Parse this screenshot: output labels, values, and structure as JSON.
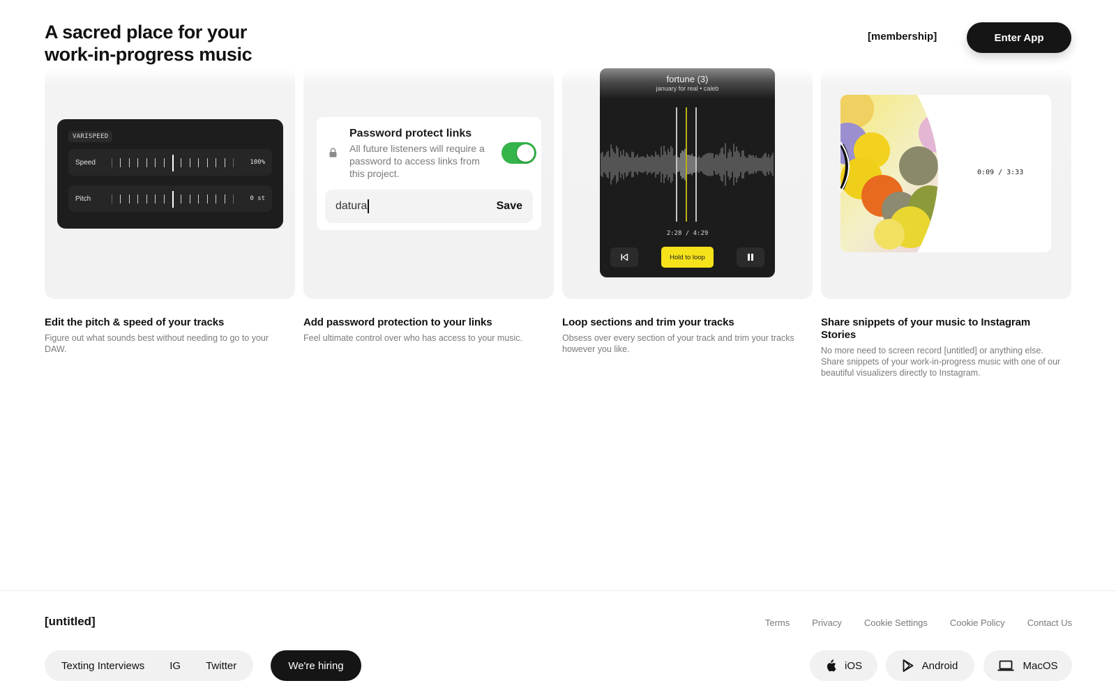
{
  "header": {
    "title": "A sacred place for your work-in-progress music",
    "membership_link": "[membership]",
    "enter_app": "Enter App"
  },
  "cards": {
    "varispeed": {
      "label": "VARISPEED",
      "rows": [
        {
          "name": "Speed",
          "value": "100%"
        },
        {
          "name": "Pitch",
          "value": "0 st"
        }
      ]
    },
    "password": {
      "title": "Password protect links",
      "description": "All future listeners will require a password to access links from this project.",
      "toggle_on": true,
      "input_value": "datura",
      "save_label": "Save"
    },
    "player": {
      "track_title": "fortune (3)",
      "track_sub": "january for real  • caleb",
      "time": "2:28 / 4:29",
      "hold_to_loop": "Hold to loop"
    },
    "snippet": {
      "time": "0:09 / 3:33"
    }
  },
  "features": [
    {
      "title": "Edit the pitch & speed of your tracks",
      "desc": "Figure out what sounds best without needing to go to your DAW."
    },
    {
      "title": "Add password protection to your links",
      "desc": "Feel ultimate control over who has access to your music."
    },
    {
      "title": "Loop sections and trim your tracks",
      "desc": "Obsess over every section of your track and trim your tracks however you like."
    },
    {
      "title": "Share snippets of your music to Instagram Stories",
      "desc": "No more need to screen record [untitled] or anything else. Share snippets of your work-in-progress music with one of our beautiful visualizers directly to Instagram."
    }
  ],
  "footer": {
    "brand": "[untitled]",
    "links": [
      "Terms",
      "Privacy",
      "Cookie Settings",
      "Cookie Policy",
      "Contact Us"
    ],
    "social": [
      "Texting Interviews",
      "IG",
      "Twitter"
    ],
    "hiring": "We're hiring",
    "platforms": [
      "iOS",
      "Android",
      "MacOS"
    ]
  },
  "colors": {
    "accent_yellow": "#f5e21a",
    "toggle_green": "#34b44a",
    "dark": "#151515"
  }
}
